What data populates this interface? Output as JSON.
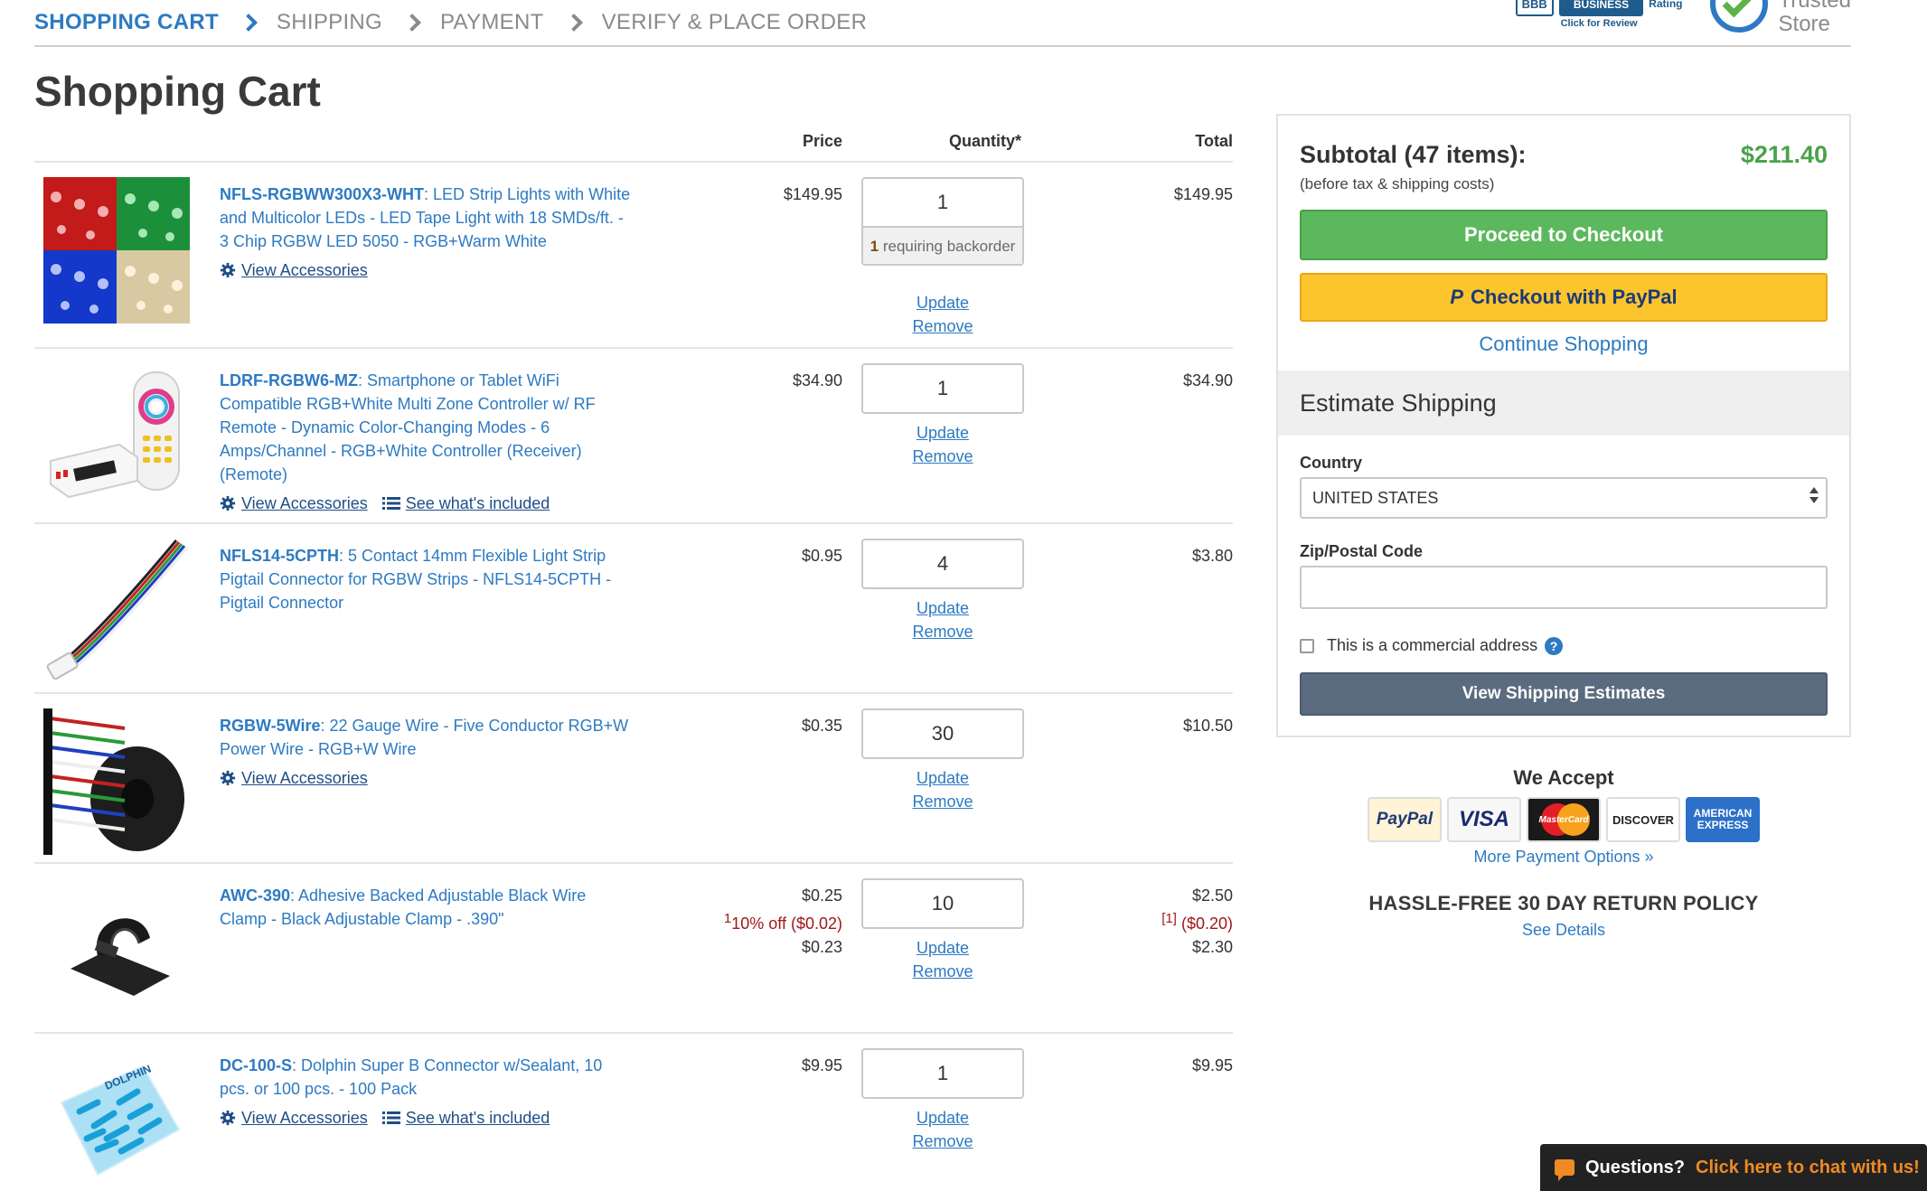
{
  "steps": [
    "SHOPPING CART",
    "SHIPPING",
    "PAYMENT",
    "VERIFY & PLACE ORDER"
  ],
  "badges": {
    "bbb_logo": "BBB",
    "bbb_business": "BUSINESS",
    "bbb_rating": "Rating",
    "bbb_click": "Click for Review",
    "trusted_line1": "Trusted",
    "trusted_line2": "Store"
  },
  "page_title": "Shopping Cart",
  "columns": {
    "price": "Price",
    "quantity": "Quantity*",
    "total": "Total"
  },
  "items": [
    {
      "sku": "NFLS-RGBWW300X3-WHT",
      "desc": ": LED Strip Lights with White and Multicolor LEDs - LED Tape Light with 18 SMDs/ft. - 3 Chip RGBW LED 5050 - RGB+Warm White",
      "link1": "View Accessories",
      "price": "$149.95",
      "qty": "1",
      "backorder_num": "1",
      "backorder_text": " requiring backorder",
      "total": "$149.95",
      "update": "Update",
      "remove": "Remove"
    },
    {
      "sku": "LDRF-RGBW6-MZ",
      "desc": ": Smartphone or Tablet WiFi Compatible RGB+White Multi Zone Controller w/ RF Remote - Dynamic Color-Changing Modes - 6 Amps/Channel - RGB+White Controller (Receiver) (Remote)",
      "link1": "View Accessories",
      "link2": "See what's included",
      "price": "$34.90",
      "qty": "1",
      "total": "$34.90",
      "update": "Update",
      "remove": "Remove"
    },
    {
      "sku": "NFLS14-5CPTH",
      "desc": ": 5 Contact 14mm Flexible Light Strip Pigtail Connector for RGBW Strips - NFLS14-5CPTH - Pigtail Connector",
      "price": "$0.95",
      "qty": "4",
      "total": "$3.80",
      "update": "Update",
      "remove": "Remove"
    },
    {
      "sku": "RGBW-5Wire",
      "desc": ": 22 Gauge Wire - Five Conductor RGB+W Power Wire - RGB+W Wire",
      "link1": "View Accessories",
      "price": "$0.35",
      "qty": "30",
      "total": "$10.50",
      "update": "Update",
      "remove": "Remove"
    },
    {
      "sku": "AWC-390",
      "desc": ": Adhesive Backed Adjustable Black Wire Clamp - Black Adjustable Clamp - .390\"",
      "price": "$0.25",
      "discount_sup": "1",
      "discount": "10% off ($0.02)",
      "price_final": "$0.23",
      "qty": "10",
      "total": "$2.50",
      "total_disc_ref": "[1]",
      "total_disc": " ($0.20)",
      "total_final": "$2.30",
      "update": "Update",
      "remove": "Remove"
    },
    {
      "sku": "DC-100-S",
      "desc": ": Dolphin Super B Connector w/Sealant, 10 pcs. or 100 pcs. - 100 Pack",
      "link1": "View Accessories",
      "link2": "See what's included",
      "price": "$9.95",
      "qty": "1",
      "total": "$9.95",
      "update": "Update",
      "remove": "Remove"
    }
  ],
  "summary": {
    "subtotal_label": "Subtotal (47 items):",
    "subtotal_value": "$211.40",
    "note": "(before tax & shipping costs)",
    "checkout": "Proceed to Checkout",
    "paypal_mark": "P",
    "paypal": "Checkout with PayPal",
    "continue": "Continue Shopping",
    "estimate_title": "Estimate Shipping",
    "country_label": "Country",
    "country_value": "UNITED STATES",
    "zip_label": "Zip/Postal Code",
    "zip_value": "",
    "commercial": "This is a commercial address",
    "help": "?",
    "view_estimates": "View Shipping Estimates"
  },
  "accept": {
    "title": "We Accept",
    "cards": {
      "paypal": "PayPal",
      "visa": "VISA",
      "mastercard": "MasterCard",
      "discover": "DISCOVER",
      "amex_1": "AMERICAN",
      "amex_2": "EXPRESS"
    },
    "more": "More Payment Options »",
    "return_policy": "HASSLE-FREE 30 DAY RETURN POLICY",
    "see_details": "See Details"
  },
  "chat": {
    "question": "Questions?",
    "link": "Click here to chat with us!"
  },
  "colors": {
    "link": "#2d7ac2",
    "checkout": "#5cb85c",
    "paypal": "#fcc52d",
    "ship_btn": "#5b6b80",
    "subtotal": "#4aa24a",
    "discount": "#a01818"
  }
}
